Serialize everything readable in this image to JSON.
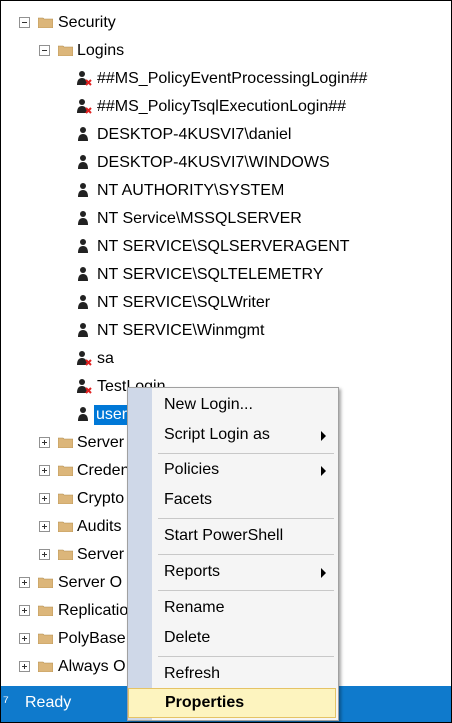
{
  "tree": {
    "security": "Security",
    "logins": "Logins",
    "login_items": [
      "##MS_PolicyEventProcessingLogin##",
      "##MS_PolicyTsqlExecutionLogin##",
      "DESKTOP-4KUSVI7\\daniel",
      "DESKTOP-4KUSVI7\\WINDOWS",
      "NT AUTHORITY\\SYSTEM",
      "NT Service\\MSSQLSERVER",
      "NT SERVICE\\SQLSERVERAGENT",
      "NT SERVICE\\SQLTELEMETRY",
      "NT SERVICE\\SQLWriter",
      "NT SERVICE\\Winmgmt",
      "sa",
      "TestLogin",
      "user"
    ],
    "security_children": [
      "Server",
      "Creden",
      "Crypto",
      "Audits",
      "Server"
    ],
    "top_level": [
      "Server O",
      "Replicatio",
      "PolyBase",
      "Always O"
    ]
  },
  "status": {
    "text": "Ready"
  },
  "context_menu": {
    "items": [
      "New Login...",
      "Script Login as",
      "Policies",
      "Facets",
      "Start PowerShell",
      "Reports",
      "Rename",
      "Delete",
      "Refresh"
    ],
    "highlighted": "Properties"
  },
  "colors": {
    "selection": "#0078d7",
    "statusbar": "#0f7acc",
    "menu_highlight": "#fdf4bf"
  }
}
